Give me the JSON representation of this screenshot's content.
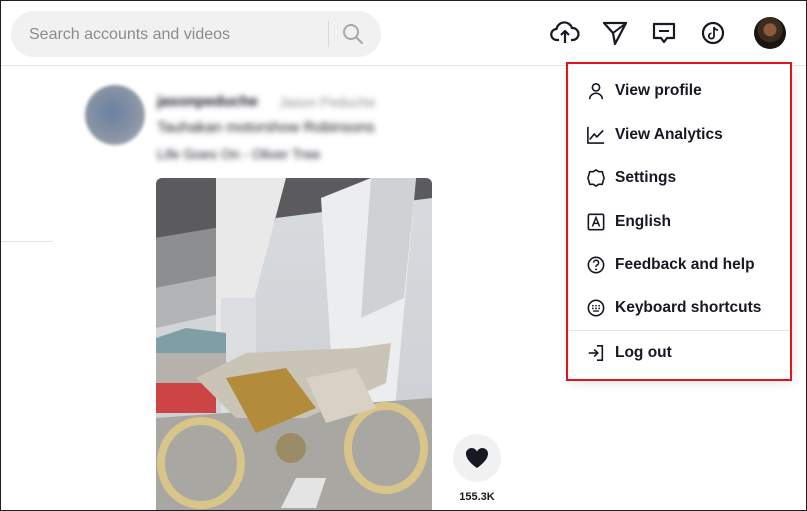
{
  "search": {
    "placeholder": "Search accounts and videos"
  },
  "header_icons": [
    "upload-icon",
    "send-icon",
    "inbox-icon",
    "tiktok-icon"
  ],
  "feed": {
    "username": "jasonpeduche",
    "nickname": "Jason Peduche",
    "caption": "Tauhakan motorshow Robinsons",
    "music": "Life Goes On - Oliver Tree",
    "like_count": "155.3K"
  },
  "menu": {
    "items": [
      {
        "label": "View profile",
        "icon": "user-icon"
      },
      {
        "label": "View Analytics",
        "icon": "analytics-icon"
      },
      {
        "label": "Settings",
        "icon": "settings-icon"
      },
      {
        "label": "English",
        "icon": "language-icon"
      },
      {
        "label": "Feedback and help",
        "icon": "help-icon"
      },
      {
        "label": "Keyboard shortcuts",
        "icon": "keyboard-icon"
      },
      {
        "label": "Log out",
        "icon": "logout-icon"
      }
    ]
  },
  "colors": {
    "highlight_border": "#e0141c",
    "text": "#161823",
    "search_bg": "#f1f1f2"
  }
}
